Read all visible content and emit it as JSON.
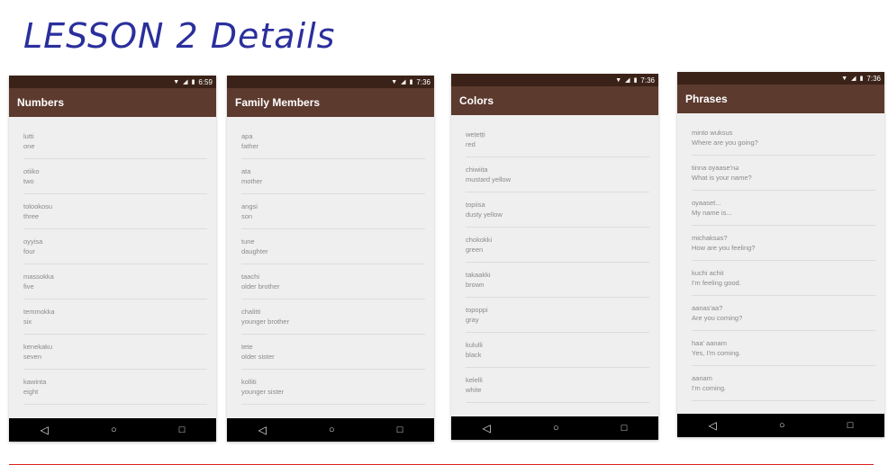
{
  "slide": {
    "title": "LESSON 2 Details"
  },
  "phones": [
    {
      "time": "6:59",
      "title": "Numbers",
      "items": [
        {
          "word": "lutti",
          "meaning": "one"
        },
        {
          "word": "otiiko",
          "meaning": "two"
        },
        {
          "word": "tolookosu",
          "meaning": "three"
        },
        {
          "word": "oyyisa",
          "meaning": "four"
        },
        {
          "word": "massokka",
          "meaning": "five"
        },
        {
          "word": "temmokka",
          "meaning": "six"
        },
        {
          "word": "kenekaku",
          "meaning": "seven"
        },
        {
          "word": "kawinta",
          "meaning": "eight"
        }
      ]
    },
    {
      "time": "7:36",
      "title": "Family Members",
      "items": [
        {
          "word": "apa",
          "meaning": "father"
        },
        {
          "word": "ata",
          "meaning": "mother"
        },
        {
          "word": "angsi",
          "meaning": "son"
        },
        {
          "word": "tune",
          "meaning": "daughter"
        },
        {
          "word": "taachi",
          "meaning": "older brother"
        },
        {
          "word": "chalitti",
          "meaning": "younger brother"
        },
        {
          "word": "tete",
          "meaning": "older sister"
        },
        {
          "word": "kolliti",
          "meaning": "younger sister"
        }
      ]
    },
    {
      "time": "7:36",
      "title": "Colors",
      "items": [
        {
          "word": "weṭeṭṭi",
          "meaning": "red"
        },
        {
          "word": "chiwiiṭa",
          "meaning": "mustard yellow"
        },
        {
          "word": "ṭopiisa",
          "meaning": "dusty yellow"
        },
        {
          "word": "chokokki",
          "meaning": "green"
        },
        {
          "word": "takaakki",
          "meaning": "brown"
        },
        {
          "word": "topoppi",
          "meaning": "gray"
        },
        {
          "word": "kululli",
          "meaning": "black"
        },
        {
          "word": "kelelli",
          "meaning": "white"
        }
      ]
    },
    {
      "time": "7:36",
      "title": "Phrases",
      "items": [
        {
          "word": "minto wuksus",
          "meaning": "Where are you going?"
        },
        {
          "word": "tinna oyaase'nə",
          "meaning": "What is your name?"
        },
        {
          "word": "oyaaset...",
          "meaning": "My name is..."
        },
        {
          "word": "michaksəs?",
          "meaning": "How are you feeling?"
        },
        {
          "word": "kuchi achit",
          "meaning": "I'm feeling good."
        },
        {
          "word": "aanas'aa?",
          "meaning": "Are you coming?"
        },
        {
          "word": "haa' aanam",
          "meaning": "Yes, I'm coming."
        },
        {
          "word": "aanam",
          "meaning": "I'm coming."
        }
      ]
    }
  ],
  "nav_icons": [
    "back-icon",
    "home-icon",
    "recents-icon"
  ],
  "status_icons": [
    "wifi-icon",
    "signal-icon",
    "battery-icon"
  ],
  "colors": {
    "title": "#2a2f9c",
    "app_bar": "#5c3a2e",
    "status_bar": "#3b2218",
    "nav_bar": "#000000",
    "list_bg": "#efefef",
    "accent_line": "#d92020"
  }
}
